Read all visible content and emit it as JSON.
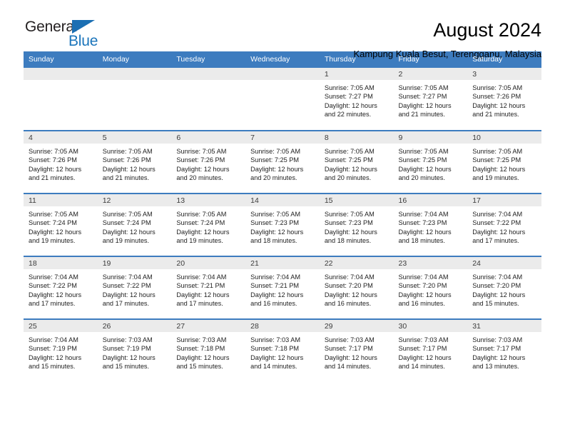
{
  "logo": {
    "word1": "General",
    "word2": "Blue",
    "triangle_color": "#1b6fb3",
    "blue_text_color": "#1b75bb"
  },
  "header": {
    "title": "August 2024",
    "subtitle": "Kampung Kuala Besut, Terengganu, Malaysia"
  },
  "theme": {
    "header_blue": "#3d7cbf",
    "daynum_band": "#ebebeb",
    "cell_bg": "#ffffff"
  },
  "calendar": {
    "weekday_headers": [
      "Sunday",
      "Monday",
      "Tuesday",
      "Wednesday",
      "Thursday",
      "Friday",
      "Saturday"
    ],
    "weeks": [
      [
        {
          "day": "",
          "empty": true,
          "sunrise": "",
          "sunset": "",
          "daylight1": "",
          "daylight2": ""
        },
        {
          "day": "",
          "empty": true,
          "sunrise": "",
          "sunset": "",
          "daylight1": "",
          "daylight2": ""
        },
        {
          "day": "",
          "empty": true,
          "sunrise": "",
          "sunset": "",
          "daylight1": "",
          "daylight2": ""
        },
        {
          "day": "",
          "empty": true,
          "sunrise": "",
          "sunset": "",
          "daylight1": "",
          "daylight2": ""
        },
        {
          "day": "1",
          "empty": false,
          "sunrise": "Sunrise: 7:05 AM",
          "sunset": "Sunset: 7:27 PM",
          "daylight1": "Daylight: 12 hours",
          "daylight2": "and 22 minutes."
        },
        {
          "day": "2",
          "empty": false,
          "sunrise": "Sunrise: 7:05 AM",
          "sunset": "Sunset: 7:27 PM",
          "daylight1": "Daylight: 12 hours",
          "daylight2": "and 21 minutes."
        },
        {
          "day": "3",
          "empty": false,
          "sunrise": "Sunrise: 7:05 AM",
          "sunset": "Sunset: 7:26 PM",
          "daylight1": "Daylight: 12 hours",
          "daylight2": "and 21 minutes."
        }
      ],
      [
        {
          "day": "4",
          "empty": false,
          "sunrise": "Sunrise: 7:05 AM",
          "sunset": "Sunset: 7:26 PM",
          "daylight1": "Daylight: 12 hours",
          "daylight2": "and 21 minutes."
        },
        {
          "day": "5",
          "empty": false,
          "sunrise": "Sunrise: 7:05 AM",
          "sunset": "Sunset: 7:26 PM",
          "daylight1": "Daylight: 12 hours",
          "daylight2": "and 21 minutes."
        },
        {
          "day": "6",
          "empty": false,
          "sunrise": "Sunrise: 7:05 AM",
          "sunset": "Sunset: 7:26 PM",
          "daylight1": "Daylight: 12 hours",
          "daylight2": "and 20 minutes."
        },
        {
          "day": "7",
          "empty": false,
          "sunrise": "Sunrise: 7:05 AM",
          "sunset": "Sunset: 7:25 PM",
          "daylight1": "Daylight: 12 hours",
          "daylight2": "and 20 minutes."
        },
        {
          "day": "8",
          "empty": false,
          "sunrise": "Sunrise: 7:05 AM",
          "sunset": "Sunset: 7:25 PM",
          "daylight1": "Daylight: 12 hours",
          "daylight2": "and 20 minutes."
        },
        {
          "day": "9",
          "empty": false,
          "sunrise": "Sunrise: 7:05 AM",
          "sunset": "Sunset: 7:25 PM",
          "daylight1": "Daylight: 12 hours",
          "daylight2": "and 20 minutes."
        },
        {
          "day": "10",
          "empty": false,
          "sunrise": "Sunrise: 7:05 AM",
          "sunset": "Sunset: 7:25 PM",
          "daylight1": "Daylight: 12 hours",
          "daylight2": "and 19 minutes."
        }
      ],
      [
        {
          "day": "11",
          "empty": false,
          "sunrise": "Sunrise: 7:05 AM",
          "sunset": "Sunset: 7:24 PM",
          "daylight1": "Daylight: 12 hours",
          "daylight2": "and 19 minutes."
        },
        {
          "day": "12",
          "empty": false,
          "sunrise": "Sunrise: 7:05 AM",
          "sunset": "Sunset: 7:24 PM",
          "daylight1": "Daylight: 12 hours",
          "daylight2": "and 19 minutes."
        },
        {
          "day": "13",
          "empty": false,
          "sunrise": "Sunrise: 7:05 AM",
          "sunset": "Sunset: 7:24 PM",
          "daylight1": "Daylight: 12 hours",
          "daylight2": "and 19 minutes."
        },
        {
          "day": "14",
          "empty": false,
          "sunrise": "Sunrise: 7:05 AM",
          "sunset": "Sunset: 7:23 PM",
          "daylight1": "Daylight: 12 hours",
          "daylight2": "and 18 minutes."
        },
        {
          "day": "15",
          "empty": false,
          "sunrise": "Sunrise: 7:05 AM",
          "sunset": "Sunset: 7:23 PM",
          "daylight1": "Daylight: 12 hours",
          "daylight2": "and 18 minutes."
        },
        {
          "day": "16",
          "empty": false,
          "sunrise": "Sunrise: 7:04 AM",
          "sunset": "Sunset: 7:23 PM",
          "daylight1": "Daylight: 12 hours",
          "daylight2": "and 18 minutes."
        },
        {
          "day": "17",
          "empty": false,
          "sunrise": "Sunrise: 7:04 AM",
          "sunset": "Sunset: 7:22 PM",
          "daylight1": "Daylight: 12 hours",
          "daylight2": "and 17 minutes."
        }
      ],
      [
        {
          "day": "18",
          "empty": false,
          "sunrise": "Sunrise: 7:04 AM",
          "sunset": "Sunset: 7:22 PM",
          "daylight1": "Daylight: 12 hours",
          "daylight2": "and 17 minutes."
        },
        {
          "day": "19",
          "empty": false,
          "sunrise": "Sunrise: 7:04 AM",
          "sunset": "Sunset: 7:22 PM",
          "daylight1": "Daylight: 12 hours",
          "daylight2": "and 17 minutes."
        },
        {
          "day": "20",
          "empty": false,
          "sunrise": "Sunrise: 7:04 AM",
          "sunset": "Sunset: 7:21 PM",
          "daylight1": "Daylight: 12 hours",
          "daylight2": "and 17 minutes."
        },
        {
          "day": "21",
          "empty": false,
          "sunrise": "Sunrise: 7:04 AM",
          "sunset": "Sunset: 7:21 PM",
          "daylight1": "Daylight: 12 hours",
          "daylight2": "and 16 minutes."
        },
        {
          "day": "22",
          "empty": false,
          "sunrise": "Sunrise: 7:04 AM",
          "sunset": "Sunset: 7:20 PM",
          "daylight1": "Daylight: 12 hours",
          "daylight2": "and 16 minutes."
        },
        {
          "day": "23",
          "empty": false,
          "sunrise": "Sunrise: 7:04 AM",
          "sunset": "Sunset: 7:20 PM",
          "daylight1": "Daylight: 12 hours",
          "daylight2": "and 16 minutes."
        },
        {
          "day": "24",
          "empty": false,
          "sunrise": "Sunrise: 7:04 AM",
          "sunset": "Sunset: 7:20 PM",
          "daylight1": "Daylight: 12 hours",
          "daylight2": "and 15 minutes."
        }
      ],
      [
        {
          "day": "25",
          "empty": false,
          "sunrise": "Sunrise: 7:04 AM",
          "sunset": "Sunset: 7:19 PM",
          "daylight1": "Daylight: 12 hours",
          "daylight2": "and 15 minutes."
        },
        {
          "day": "26",
          "empty": false,
          "sunrise": "Sunrise: 7:03 AM",
          "sunset": "Sunset: 7:19 PM",
          "daylight1": "Daylight: 12 hours",
          "daylight2": "and 15 minutes."
        },
        {
          "day": "27",
          "empty": false,
          "sunrise": "Sunrise: 7:03 AM",
          "sunset": "Sunset: 7:18 PM",
          "daylight1": "Daylight: 12 hours",
          "daylight2": "and 15 minutes."
        },
        {
          "day": "28",
          "empty": false,
          "sunrise": "Sunrise: 7:03 AM",
          "sunset": "Sunset: 7:18 PM",
          "daylight1": "Daylight: 12 hours",
          "daylight2": "and 14 minutes."
        },
        {
          "day": "29",
          "empty": false,
          "sunrise": "Sunrise: 7:03 AM",
          "sunset": "Sunset: 7:17 PM",
          "daylight1": "Daylight: 12 hours",
          "daylight2": "and 14 minutes."
        },
        {
          "day": "30",
          "empty": false,
          "sunrise": "Sunrise: 7:03 AM",
          "sunset": "Sunset: 7:17 PM",
          "daylight1": "Daylight: 12 hours",
          "daylight2": "and 14 minutes."
        },
        {
          "day": "31",
          "empty": false,
          "sunrise": "Sunrise: 7:03 AM",
          "sunset": "Sunset: 7:17 PM",
          "daylight1": "Daylight: 12 hours",
          "daylight2": "and 13 minutes."
        }
      ]
    ]
  }
}
